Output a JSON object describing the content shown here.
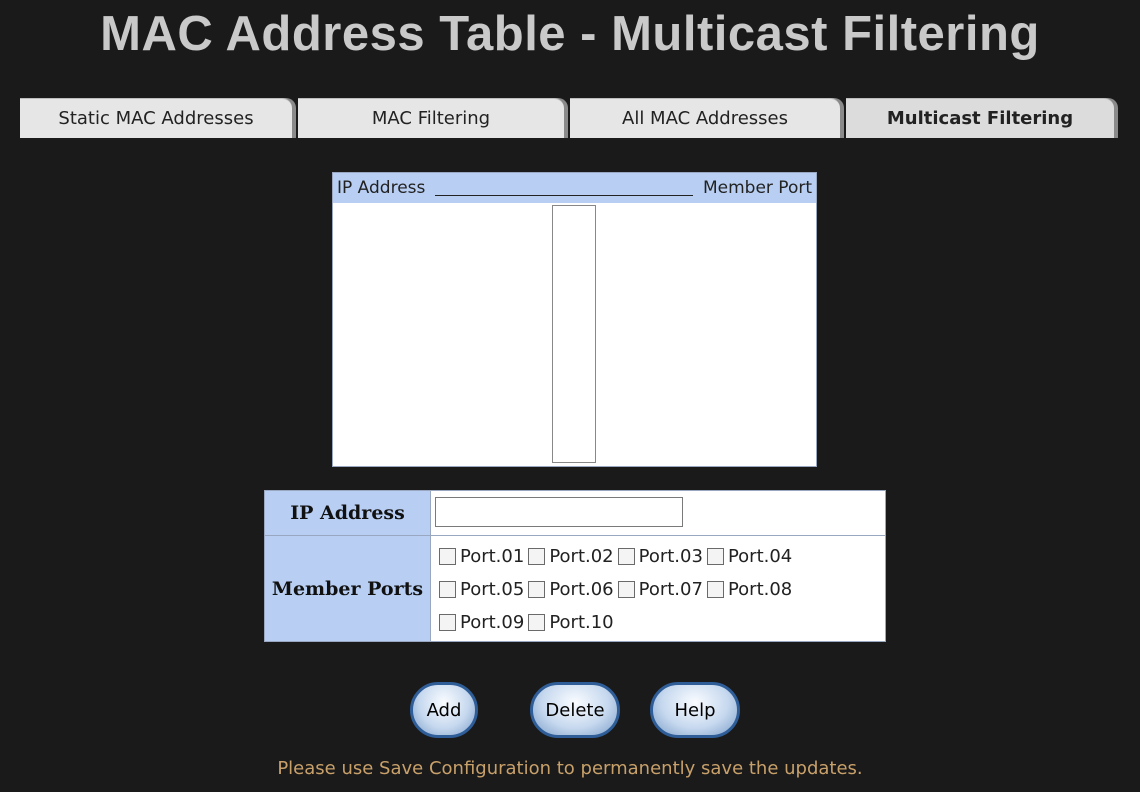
{
  "page": {
    "title": "MAC Address Table - Multicast Filtering"
  },
  "tabs": [
    {
      "label": "Static MAC Addresses"
    },
    {
      "label": "MAC Filtering"
    },
    {
      "label": "All MAC Addresses"
    },
    {
      "label": "Multicast Filtering",
      "active": true
    }
  ],
  "list": {
    "col1": "IP Address",
    "col2": "Member Port"
  },
  "form": {
    "ip_label": "IP Address",
    "ip_value": "",
    "ports_label": "Member Ports",
    "ports": [
      "Port.01",
      "Port.02",
      "Port.03",
      "Port.04",
      "Port.05",
      "Port.06",
      "Port.07",
      "Port.08",
      "Port.09",
      "Port.10"
    ]
  },
  "buttons": {
    "add": "Add",
    "delete": "Delete",
    "help": "Help"
  },
  "note": "Please use Save Configuration to permanently save the updates.",
  "colors": {
    "background": "#1a1a1a",
    "title": "#c9c9c9",
    "header_blue": "#b8cff3",
    "note": "#c8a06a"
  }
}
